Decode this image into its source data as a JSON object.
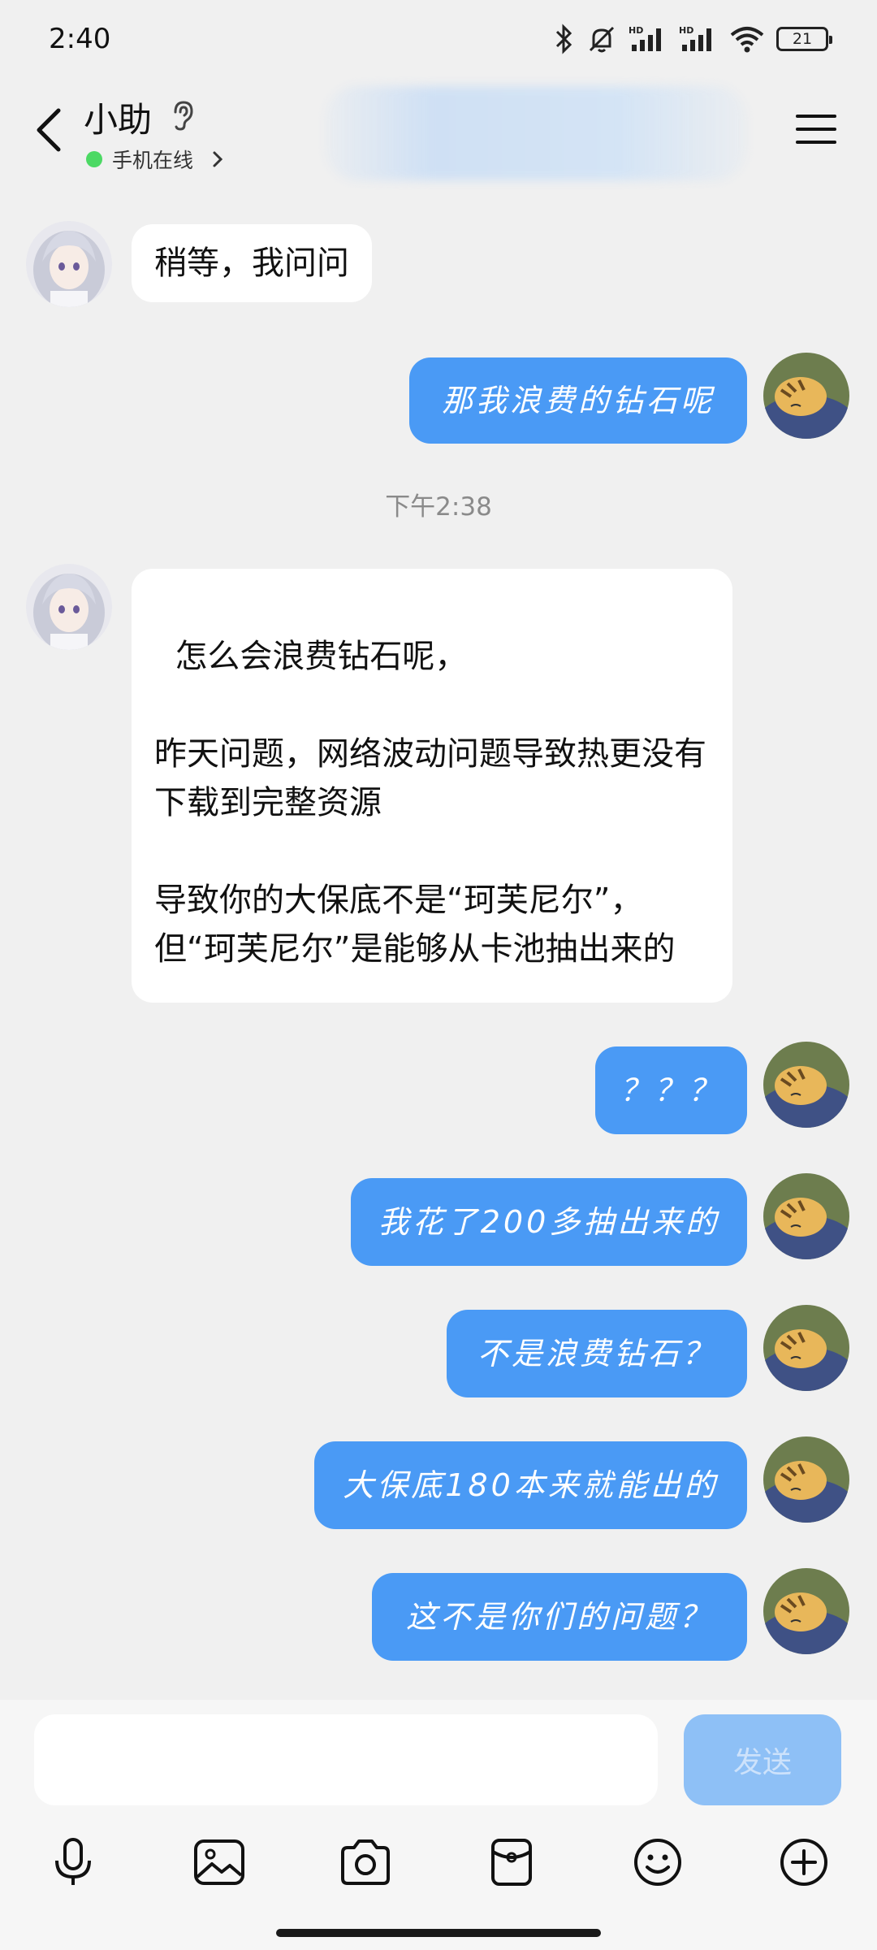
{
  "status": {
    "time": "2:40",
    "battery": "21"
  },
  "header": {
    "name": "小助",
    "status": "手机在线"
  },
  "messages": {
    "m1": "稍等，我问问",
    "m2": "那我浪费的钻石呢",
    "timestamp": "下午2:38",
    "m3": "怎么会浪费钻石呢，\n\n昨天问题，网络波动问题导致热更没有下载到完整资源\n\n导致你的大保底不是“珂芙尼尔”，但“珂芙尼尔”是能够从卡池抽出来的",
    "m4": "？？？",
    "m5": "我花了200多抽出来的",
    "m6": "不是浪费钻石？",
    "m7": "大保底180本来就能出的",
    "m8": "这不是你们的问题？"
  },
  "input": {
    "send_label": "发送",
    "value": ""
  },
  "icons": {
    "back": "back-arrow-icon",
    "ear": "ear-icon",
    "menu": "hamburger-menu-icon",
    "toolbar": [
      "microphone-icon",
      "image-icon",
      "camera-icon",
      "red-packet-icon",
      "emoji-icon",
      "plus-icon"
    ]
  },
  "colors": {
    "bubble_outgoing": "#4a9af5",
    "bubble_incoming": "#ffffff",
    "online": "#4cd964",
    "send_disabled": "#8ec0f6"
  }
}
